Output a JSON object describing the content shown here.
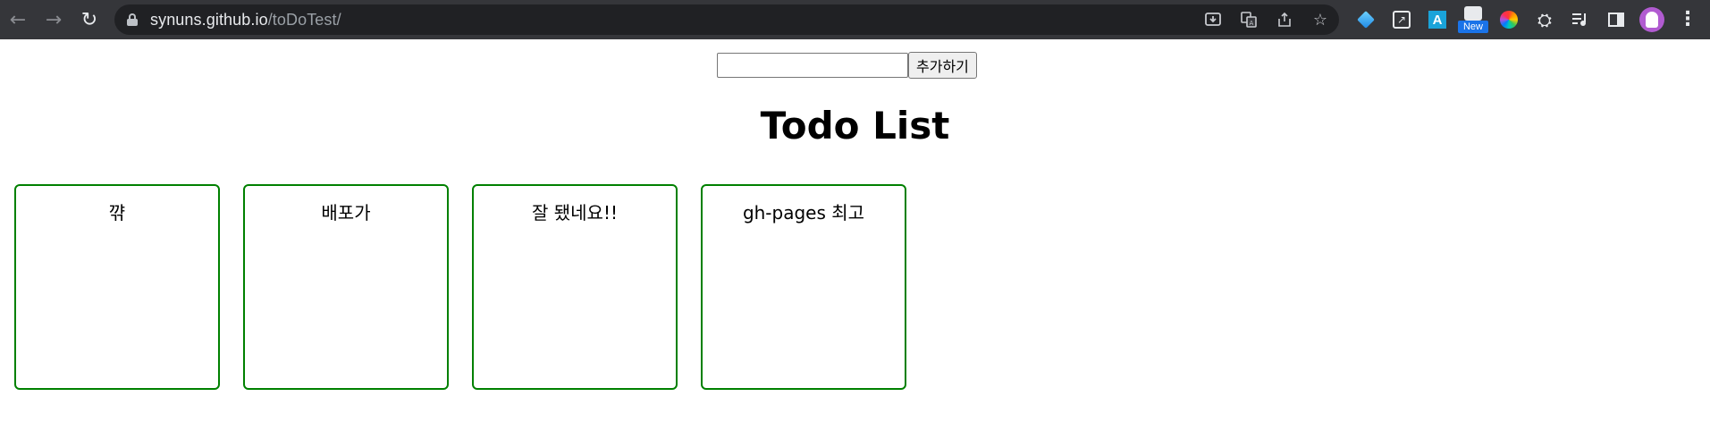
{
  "browser": {
    "url_host": "synuns.github.io",
    "url_path": "/toDoTest/",
    "extensions": [
      {
        "name": "gem-extension-icon"
      },
      {
        "name": "square-arrow-extension-icon"
      },
      {
        "name": "a-extension-icon",
        "label": "A"
      },
      {
        "name": "new-extension-icon",
        "badge": "New"
      },
      {
        "name": "color-wheel-extension-icon"
      },
      {
        "name": "puzzle-extensions-icon"
      },
      {
        "name": "media-playlist-icon"
      },
      {
        "name": "side-panel-icon"
      }
    ]
  },
  "form": {
    "input_value": "",
    "button_label": "추가하기"
  },
  "title": "Todo List",
  "todos": [
    {
      "text": "꺆"
    },
    {
      "text": "배포가"
    },
    {
      "text": "잘 됐네요!!"
    },
    {
      "text": "gh-pages 최고"
    }
  ],
  "colors": {
    "card_border": "#008000",
    "chrome_bg": "#35363a",
    "omnibox_bg": "#202124"
  }
}
